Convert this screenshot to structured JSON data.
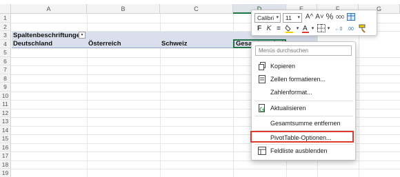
{
  "columns": [
    "A",
    "B",
    "C",
    "D",
    "E",
    "F",
    "G"
  ],
  "rows": [
    "1",
    "2",
    "3",
    "4",
    "5",
    "6",
    "7",
    "8",
    "9",
    "10",
    "11",
    "12",
    "13",
    "14",
    "15",
    "16",
    "17",
    "18",
    "19"
  ],
  "active_column": "D",
  "cells": {
    "a3": "Spaltenbeschriftungen",
    "a4": "Deutschland",
    "b4": "Österreich",
    "c4": "Schweiz",
    "d4": "Gesamtergebnis"
  },
  "filter_button": "▾",
  "mini_toolbar": {
    "font_name": "Calibri",
    "font_size": "11",
    "grow_font": "A^",
    "shrink_font": "A˅",
    "percent": "%",
    "thousands": "000",
    "bold": "F",
    "italic": "K",
    "align": "≡",
    "fill_color_hex": "#f5d000",
    "font_color_hex": "#e03a2f",
    "increase_decimal": "←0",
    "decrease_decimal": ".00"
  },
  "context_menu": {
    "search_placeholder": "Menüs durchsuchen",
    "items": [
      {
        "label": "Kopieren",
        "icon": "copy-icon"
      },
      {
        "label": "Zellen formatieren...",
        "icon": "format-cells-icon"
      },
      {
        "label": "Zahlenformat...",
        "icon": ""
      },
      {
        "label": "Aktualisieren",
        "icon": "refresh-icon"
      },
      {
        "label": "Gesamtsumme entfernen",
        "icon": ""
      },
      {
        "label": "PivotTable-Optionen...",
        "icon": ""
      },
      {
        "label": "Feldliste ausblenden",
        "icon": "field-list-icon"
      }
    ]
  },
  "highlight_color": "#e03a2f"
}
